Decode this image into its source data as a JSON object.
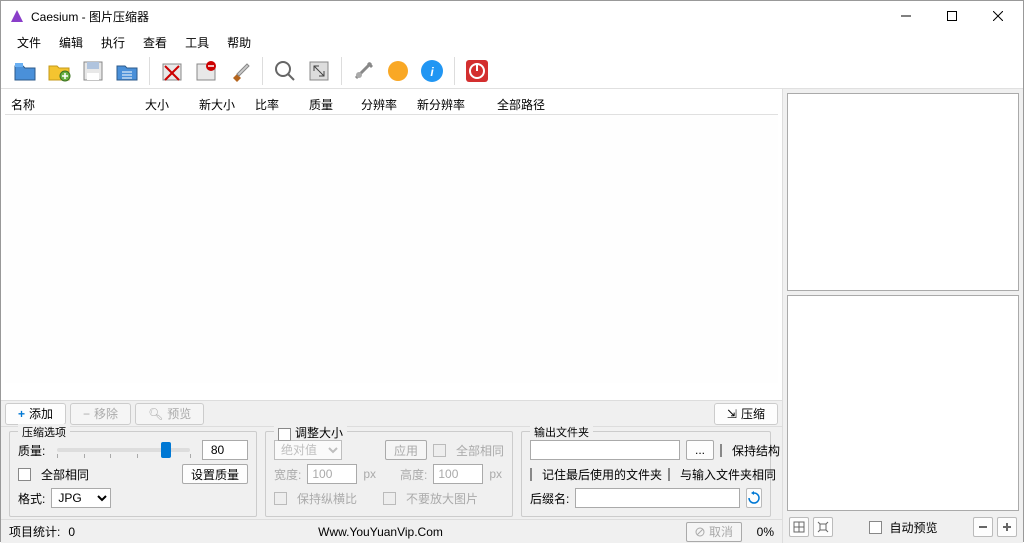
{
  "window": {
    "title": "Caesium - 图片压缩器"
  },
  "menu": {
    "file": "文件",
    "edit": "编辑",
    "execute": "执行",
    "view": "查看",
    "tools": "工具",
    "help": "帮助"
  },
  "columns": {
    "name": "名称",
    "size": "大小",
    "newsize": "新大小",
    "ratio": "比率",
    "quality": "质量",
    "resolution": "分辨率",
    "newresolution": "新分辨率",
    "fullpath": "全部路径"
  },
  "actions": {
    "add": "添加",
    "remove": "移除",
    "preview": "预览",
    "compress": "压缩"
  },
  "compress": {
    "legend": "压缩选项",
    "quality_label": "质量:",
    "quality_value": "80",
    "same_all": "全部相同",
    "set_quality": "设置质量",
    "format_label": "格式:",
    "format_value": "JPG"
  },
  "resize": {
    "legend": "调整大小",
    "mode_value": "绝对值",
    "apply": "应用",
    "same_all": "全部相同",
    "width_label": "宽度:",
    "width_value": "100",
    "unit": "px",
    "height_label": "高度:",
    "height_value": "100",
    "keep_ratio": "保持纵横比",
    "no_enlarge": "不要放大图片"
  },
  "output": {
    "legend": "输出文件夹",
    "browse": "...",
    "keep_structure": "保持结构",
    "remember": "记住最后使用的文件夹",
    "same_as_input": "与输入文件夹相同",
    "suffix_label": "后缀名:",
    "suffix_value": ""
  },
  "status": {
    "count_label": "项目统计:",
    "count_value": "0",
    "site": "Www.YouYuanVip.Com",
    "cancel": "取消",
    "percent": "0%",
    "auto_preview": "自动预览"
  }
}
